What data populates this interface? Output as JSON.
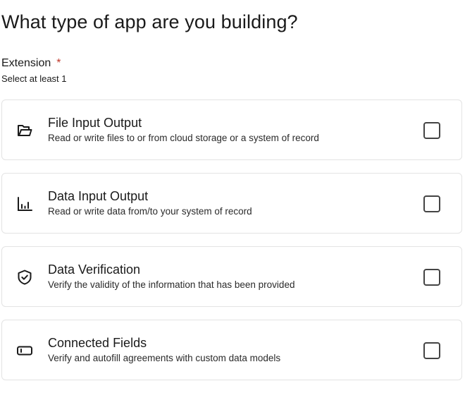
{
  "page": {
    "title": "What type of app are you building?"
  },
  "field": {
    "label": "Extension",
    "required_marker": "*",
    "hint": "Select at least 1"
  },
  "options": [
    {
      "title": "File Input Output",
      "description": "Read or write files to or from cloud storage or a system of record",
      "icon": "folder-open-icon",
      "checked": false
    },
    {
      "title": "Data Input Output",
      "description": "Read or write data from/to your system of record",
      "icon": "bar-chart-icon",
      "checked": false
    },
    {
      "title": "Data Verification",
      "description": "Verify the validity of the information that has been provided",
      "icon": "shield-check-icon",
      "checked": false
    },
    {
      "title": "Connected Fields",
      "description": "Verify and autofill agreements with custom data models",
      "icon": "input-field-icon",
      "checked": false
    }
  ]
}
